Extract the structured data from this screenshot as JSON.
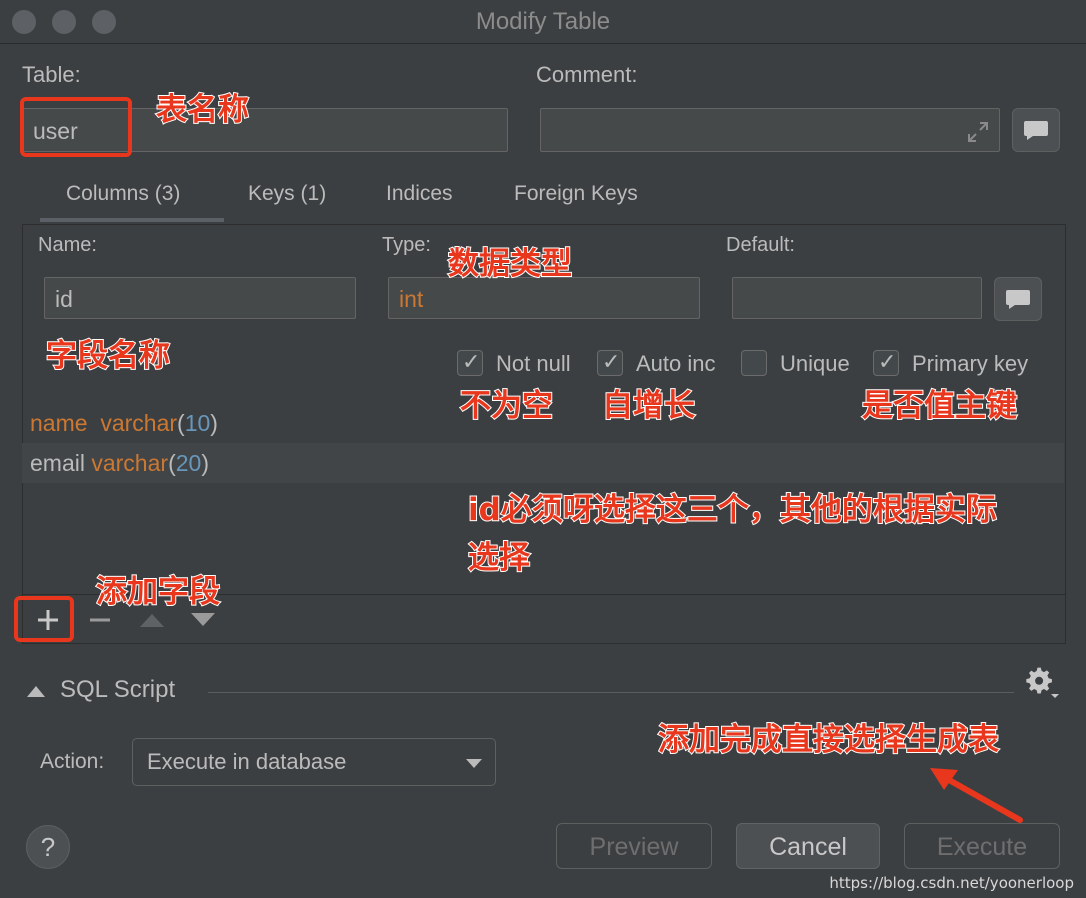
{
  "window": {
    "title": "Modify Table"
  },
  "table": {
    "label": "Table:",
    "value": "user"
  },
  "comment": {
    "label": "Comment:",
    "value": ""
  },
  "tabs": [
    {
      "label": "Columns (3)"
    },
    {
      "label": "Keys (1)"
    },
    {
      "label": "Indices"
    },
    {
      "label": "Foreign Keys"
    }
  ],
  "column_editor": {
    "name_label": "Name:",
    "name_value": "id",
    "type_label": "Type:",
    "type_value": "int",
    "default_label": "Default:",
    "default_value": ""
  },
  "checkboxes": [
    {
      "label": "Not null",
      "checked": true
    },
    {
      "label": "Auto inc",
      "checked": true
    },
    {
      "label": "Unique",
      "checked": false
    },
    {
      "label": "Primary key",
      "checked": true
    }
  ],
  "columns_list": [
    {
      "name": "name",
      "type": "varchar",
      "size": "10"
    },
    {
      "name": "email",
      "type": "varchar",
      "size": "20"
    }
  ],
  "sql_section": {
    "title": "SQL Script",
    "action_label": "Action:",
    "action_value": "Execute in database"
  },
  "buttons": {
    "help": "?",
    "preview": "Preview",
    "cancel": "Cancel",
    "execute": "Execute"
  },
  "annotations": {
    "table_name": "表名称",
    "data_type": "数据类型",
    "field_name": "字段名称",
    "not_null": "不为空",
    "auto_inc": "自增长",
    "primary_key": "是否值主键",
    "id_note_line1": "id必须呀选择这三个，其他的根据实际",
    "id_note_line2": "选择",
    "add_field": "添加字段",
    "finish_note": "添加完成直接选择生成表"
  },
  "watermark": "https://blog.csdn.net/yoonerloop",
  "colors": {
    "accent": "#4a88c7",
    "annotation": "#e8371d",
    "keyword": "#cc7832",
    "number": "#6897bb"
  }
}
